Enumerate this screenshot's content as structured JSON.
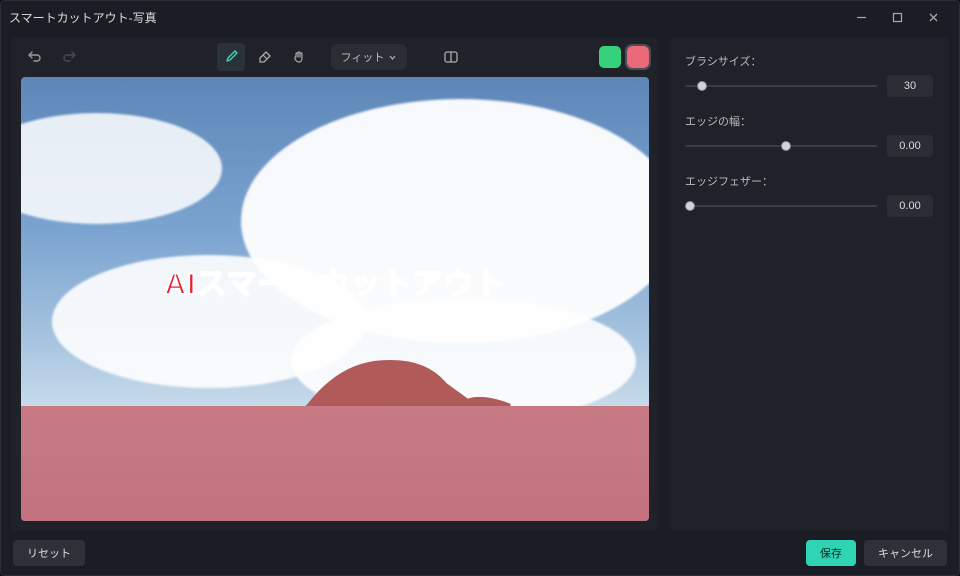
{
  "window": {
    "title": "スマートカットアウト-写真"
  },
  "toolbar": {
    "fit_label": "フィット",
    "icons": {
      "undo": "undo-icon",
      "redo": "redo-icon",
      "brush": "brush-icon",
      "eraser": "eraser-icon",
      "hand": "hand-icon",
      "compare": "compare-icon"
    },
    "swatches": {
      "keep": "#36d17b",
      "remove": "#e96a79"
    }
  },
  "canvas": {
    "overlay_text": "AIスマートカットアウト",
    "overlay_arrow": "↓"
  },
  "controls": {
    "brush_size": {
      "label": "ブラシサイズ：",
      "value": "30",
      "min": 0,
      "max": 300,
      "pos": 6
    },
    "edge_width": {
      "label": "エッジの幅：",
      "value": "0.00",
      "min": 0,
      "max": 1,
      "pos": 50
    },
    "edge_feather": {
      "label": "エッジフェザー：",
      "value": "0.00",
      "min": 0,
      "max": 1,
      "pos": 0
    }
  },
  "footer": {
    "reset": "リセット",
    "save": "保存",
    "cancel": "キャンセル"
  }
}
